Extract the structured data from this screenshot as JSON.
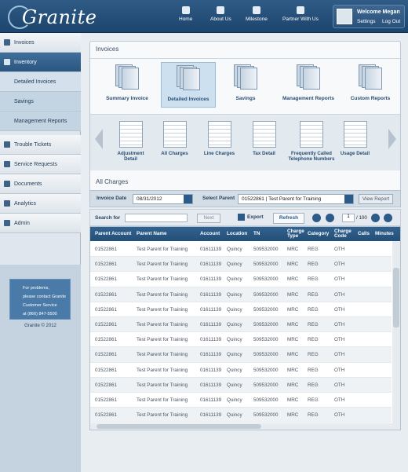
{
  "app": {
    "logo": "Granite"
  },
  "nav": [
    {
      "label": "Home",
      "icon": "home-icon"
    },
    {
      "label": "About Us",
      "icon": "people-icon"
    },
    {
      "label": "Milestone",
      "icon": "gauge-icon"
    },
    {
      "label": "Partner With Us",
      "icon": "handshake-icon"
    }
  ],
  "user": {
    "welcome": "Welcome Megan",
    "settings": "Settings",
    "logout": "Log Out"
  },
  "sidebar": {
    "items": [
      {
        "label": "Invoices"
      },
      {
        "label": "Inventory"
      },
      {
        "label": "Detailed Invoices"
      },
      {
        "label": "Savings"
      },
      {
        "label": "Management Reports"
      },
      {
        "label": "Trouble Tickets"
      },
      {
        "label": "Service Requests"
      },
      {
        "label": "Documents"
      },
      {
        "label": "Analytics"
      },
      {
        "label": "Admin"
      }
    ],
    "help_lines": [
      "For problems,",
      "please contact Granite",
      "Customer Service",
      "at (866) 847-5500"
    ],
    "copyright": "Granite © 2012"
  },
  "invoices_panel": {
    "title": "Invoices",
    "categories": [
      {
        "label": "Summary Invoice"
      },
      {
        "label": "Detailed Invoices"
      },
      {
        "label": "Savings"
      },
      {
        "label": "Management Reports"
      },
      {
        "label": "Custom Reports"
      }
    ],
    "subcategories": [
      {
        "line1": "Adjustment",
        "line2": "Detail"
      },
      {
        "line1": "All Charges",
        "line2": ""
      },
      {
        "line1": "Line Charges",
        "line2": ""
      },
      {
        "line1": "Tax Detail",
        "line2": ""
      },
      {
        "line1": "Frequently Called",
        "line2": "Telephone Numbers"
      },
      {
        "line1": "Usage Detail",
        "line2": ""
      }
    ]
  },
  "charges": {
    "title": "All Charges",
    "invoice_date_label": "Invoice Date",
    "invoice_date": "08/31/2012",
    "select_parent_label": "Select Parent",
    "parent_value": "01522861  |  Test Parent for Training",
    "view_report": "View Report",
    "search_label": "Search for",
    "next": "Next",
    "export": "Export",
    "refresh": "Refresh",
    "page": "1",
    "page_of": "/ 100",
    "columns": [
      "Parent Account",
      "Parent Name",
      "Account",
      "Location",
      "TN",
      "Charge Type",
      "Category",
      "Charge Code",
      "Calls",
      "Minutes"
    ],
    "rows": [
      [
        "01522861",
        "Test Parent for Training",
        "01611139",
        "Quincy",
        "509532000",
        "MRC",
        "REG",
        "OTH"
      ],
      [
        "01522861",
        "Test Parent for Training",
        "01611139",
        "Quincy",
        "509532000",
        "MRC",
        "REG",
        "OTH"
      ],
      [
        "01522861",
        "Test Parent for Training",
        "01611139",
        "Quincy",
        "509532000",
        "MRC",
        "REG",
        "OTH"
      ],
      [
        "01522861",
        "Test Parent for Training",
        "01611139",
        "Quincy",
        "509532000",
        "MRC",
        "REG",
        "OTH"
      ],
      [
        "01522861",
        "Test Parent for Training",
        "01611139",
        "Quincy",
        "509532000",
        "MRC",
        "REG",
        "OTH"
      ],
      [
        "01522861",
        "Test Parent for Training",
        "01611139",
        "Quincy",
        "509532000",
        "MRC",
        "REG",
        "OTH"
      ],
      [
        "01522861",
        "Test Parent for Training",
        "01611139",
        "Quincy",
        "509532000",
        "MRC",
        "REG",
        "OTH"
      ],
      [
        "01522861",
        "Test Parent for Training",
        "01611139",
        "Quincy",
        "509532000",
        "MRC",
        "REG",
        "OTH"
      ],
      [
        "01522861",
        "Test Parent for Training",
        "01611139",
        "Quincy",
        "509532000",
        "MRC",
        "REG",
        "OTH"
      ],
      [
        "01522861",
        "Test Parent for Training",
        "01611139",
        "Quincy",
        "509532000",
        "MRC",
        "REG",
        "OTH"
      ],
      [
        "01522861",
        "Test Parent for Training",
        "01611139",
        "Quincy",
        "509532000",
        "MRC",
        "REG",
        "OTH"
      ],
      [
        "01522861",
        "Test Parent for Training",
        "01611139",
        "Quincy",
        "509532000",
        "MRC",
        "REG",
        "OTH"
      ]
    ]
  }
}
